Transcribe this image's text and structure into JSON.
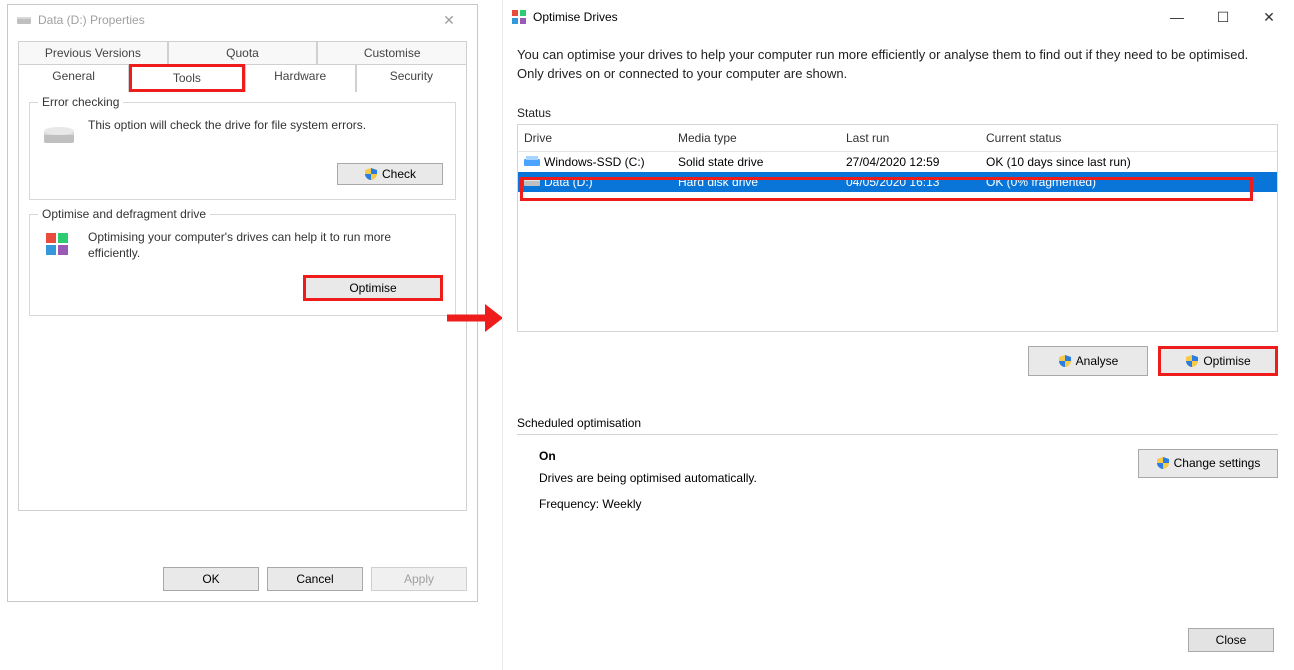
{
  "left": {
    "title": "Data (D:) Properties",
    "tabs_row1": [
      "Previous Versions",
      "Quota",
      "Customise"
    ],
    "tabs_row2": [
      "General",
      "Tools",
      "Hardware",
      "Security"
    ],
    "error_group_title": "Error checking",
    "error_group_text": "This option will check the drive for file system errors.",
    "check_label": "Check",
    "opt_group_title": "Optimise and defragment drive",
    "opt_group_text": "Optimising your computer's drives can help it to run more efficiently.",
    "optimise_label": "Optimise",
    "ok": "OK",
    "cancel": "Cancel",
    "apply": "Apply"
  },
  "right": {
    "title": "Optimise Drives",
    "intro": "You can optimise your drives to help your computer run more efficiently or analyse them to find out if they need to be optimised. Only drives on or connected to your computer are shown.",
    "status_label": "Status",
    "columns": {
      "drive": "Drive",
      "media": "Media type",
      "last": "Last run",
      "status": "Current status"
    },
    "rows": [
      {
        "name": "Windows-SSD (C:)",
        "media": "Solid state drive",
        "last": "27/04/2020 12:59",
        "status": "OK (10 days since last run)",
        "selected": false,
        "icon": "ssd"
      },
      {
        "name": "Data (D:)",
        "media": "Hard disk drive",
        "last": "04/05/2020 16:13",
        "status": "OK (0% fragmented)",
        "selected": true,
        "icon": "hdd"
      }
    ],
    "analyse": "Analyse",
    "optimise": "Optimise",
    "sched_label": "Scheduled optimisation",
    "sched_on": "On",
    "sched_text": "Drives are being optimised automatically.",
    "sched_freq": "Frequency: Weekly",
    "change": "Change settings",
    "close": "Close"
  }
}
